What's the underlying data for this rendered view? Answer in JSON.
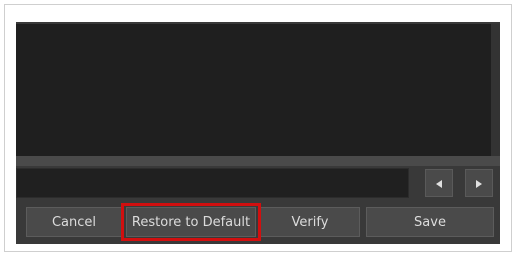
{
  "buttons": {
    "cancel_label": "Cancel",
    "restore_label": "Restore to Default",
    "verify_label": "Verify",
    "save_label": "Save"
  },
  "nav": {
    "prev_icon": "triangle-left-icon",
    "next_icon": "triangle-right-icon"
  },
  "input": {
    "value": ""
  },
  "colors": {
    "highlight": "#d10f0f",
    "panel_bg": "#393939",
    "output_bg": "#1f1f1f"
  }
}
